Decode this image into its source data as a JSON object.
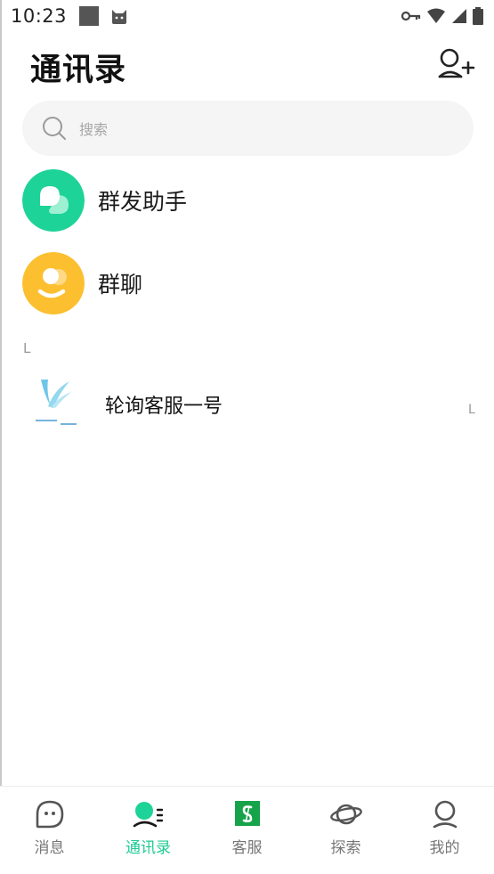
{
  "status_bar": {
    "time": "10:23"
  },
  "header": {
    "title": "通讯录",
    "add_icon": "add-contact-icon"
  },
  "search": {
    "placeholder": "搜索",
    "icon": "search-icon"
  },
  "special_items": [
    {
      "label": "群发助手",
      "icon": "broadcast-assistant-icon",
      "color": "#1ed397"
    },
    {
      "label": "群聊",
      "icon": "group-chat-icon",
      "color": "#fcbf2f"
    }
  ],
  "sections": [
    {
      "letter": "L",
      "contacts": [
        {
          "name": "轮询客服一号"
        }
      ]
    }
  ],
  "index_bar": [
    "L"
  ],
  "tabs": [
    {
      "label": "消息",
      "icon": "message-icon",
      "active": false
    },
    {
      "label": "通讯录",
      "icon": "contacts-icon",
      "active": true
    },
    {
      "label": "客服",
      "icon": "customer-service-icon",
      "active": false
    },
    {
      "label": "探索",
      "icon": "planet-icon",
      "active": false
    },
    {
      "label": "我的",
      "icon": "profile-icon",
      "active": false
    }
  ],
  "colors": {
    "accent": "#1ecb93",
    "broadcast": "#1ed397",
    "group": "#fcbf2f",
    "service": "#16a34a"
  }
}
